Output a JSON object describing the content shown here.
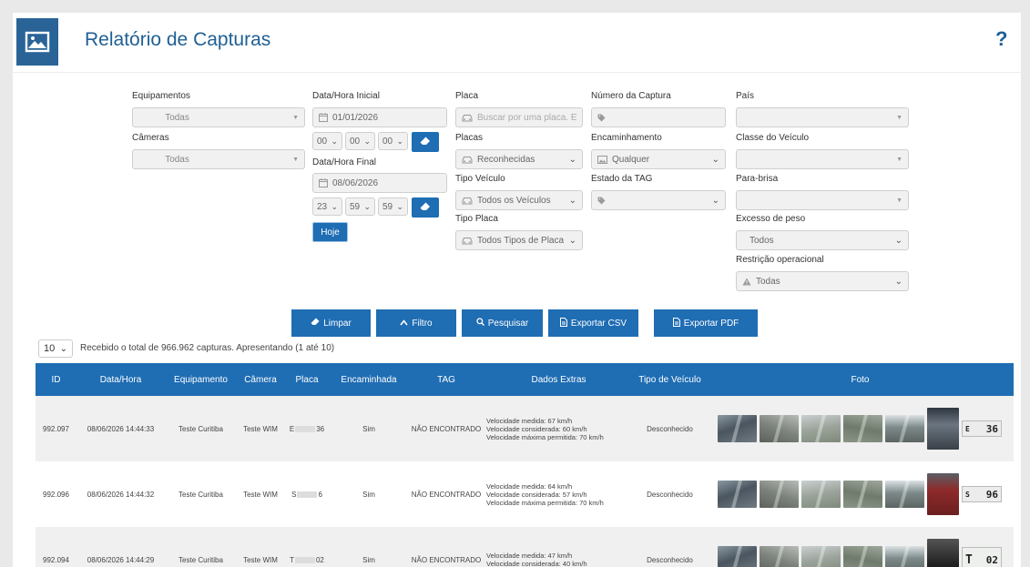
{
  "header": {
    "title": "Relatório de Capturas",
    "help_label": "?"
  },
  "filters": {
    "equipamentos": {
      "label": "Equipamentos",
      "value": "Todas"
    },
    "cameras": {
      "label": "Câmeras",
      "value": "Todas"
    },
    "data_inicial": {
      "label": "Data/Hora Inicial",
      "value": "01/01/2026",
      "hour": "00",
      "minute": "00",
      "second": "00"
    },
    "data_final": {
      "label": "Data/Hora Final",
      "value": "08/06/2026",
      "hour": "23",
      "minute": "59",
      "second": "59"
    },
    "hoje_label": "Hoje",
    "placa": {
      "label": "Placa",
      "placeholder": "Buscar por uma placa. E"
    },
    "placas": {
      "label": "Placas",
      "value": "Reconhecidas"
    },
    "tipo_veiculo": {
      "label": "Tipo Veículo",
      "value": "Todos os Veículos"
    },
    "tipo_placa": {
      "label": "Tipo Placa",
      "value": "Todos Tipos de Placa"
    },
    "numero_captura": {
      "label": "Número da Captura",
      "value": ""
    },
    "encaminhamento": {
      "label": "Encaminhamento",
      "value": "Qualquer"
    },
    "estado_tag": {
      "label": "Estado da TAG",
      "value": ""
    },
    "pais": {
      "label": "País",
      "value": ""
    },
    "classe_veiculo": {
      "label": "Classe do Veículo",
      "value": ""
    },
    "para_brisa": {
      "label": "Para-brisa",
      "value": ""
    },
    "excesso_peso": {
      "label": "Excesso de peso",
      "value": "Todos"
    },
    "restricao": {
      "label": "Restrição operacional",
      "value": "Todas"
    }
  },
  "actions": {
    "limpar": "Limpar",
    "filtro": "Filtro",
    "pesquisar": "Pesquisar",
    "exportar_csv": "Exportar CSV",
    "exportar_pdf": "Exportar PDF"
  },
  "page_size": "10",
  "summary": "Recebido o total de 966.962 capturas. Apresentando (1 até 10)",
  "table": {
    "headers": {
      "id": "ID",
      "data_hora": "Data/Hora",
      "equipamento": "Equipamento",
      "camera": "Câmera",
      "placa": "Placa",
      "encaminhada": "Encaminhada",
      "tag": "TAG",
      "dados_extras": "Dados Extras",
      "tipo_veiculo": "Tipo de Veículo",
      "foto": "Foto"
    },
    "rows": [
      {
        "id": "992.097",
        "data_hora": "08/06/2026 14:44:33",
        "equipamento": "Teste Curitiba",
        "camera": "Teste WIM",
        "placa_start": "E",
        "placa_end": "36",
        "encaminhada": "Sim",
        "tag": "NÃO ENCONTRADO",
        "vel_medida": "Velocidade medida: 67 km/h",
        "vel_considerada": "Velocidade considerada: 60 km/h",
        "vel_maxima": "Velocidade máxima permitida: 70 km/h",
        "tipo_veiculo": "Desconhecido",
        "plate_start": "E",
        "plate_end": "36"
      },
      {
        "id": "992.096",
        "data_hora": "08/06/2026 14:44:32",
        "equipamento": "Teste Curitiba",
        "camera": "Teste WIM",
        "placa_start": "S",
        "placa_end": "6",
        "encaminhada": "Sim",
        "tag": "NÃO ENCONTRADO",
        "vel_medida": "Velocidade medida: 64 km/h",
        "vel_considerada": "Velocidade considerada: 57 km/h",
        "vel_maxima": "Velocidade máxima permitida: 70 km/h",
        "tipo_veiculo": "Desconhecido",
        "plate_start": "S",
        "plate_end": "96"
      },
      {
        "id": "992.094",
        "data_hora": "08/06/2026 14:44:29",
        "equipamento": "Teste Curitiba",
        "camera": "Teste WIM",
        "placa_start": "T",
        "placa_end": "02",
        "encaminhada": "Sim",
        "tag": "NÃO ENCONTRADO",
        "vel_medida": "Velocidade medida: 47 km/h",
        "vel_considerada": "Velocidade considerada: 40 km/h",
        "vel_maxima": "",
        "tipo_veiculo": "Desconhecido",
        "plate_start": "T",
        "plate_end": "02"
      }
    ]
  },
  "icons": {
    "header": "image-icon",
    "calendar": "calendar-icon",
    "car": "car-icon",
    "tag": "tag-icon",
    "warning": "warning-icon",
    "eraser": "eraser-icon"
  },
  "colors": {
    "primary": "#1f6db3",
    "title": "#1f5f94",
    "tag_not_found": "#d9502a"
  }
}
